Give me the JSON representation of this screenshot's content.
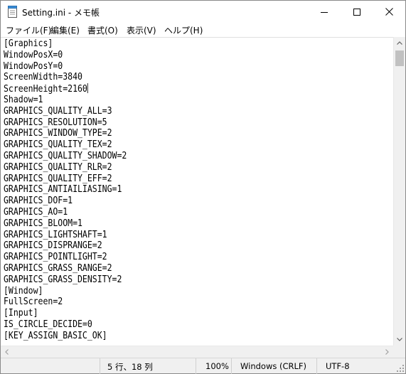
{
  "window": {
    "title": "Setting.ini - メモ帳",
    "icon": "notepad-icon"
  },
  "menu": [
    {
      "label": "ファイル(F)"
    },
    {
      "label": "編集(E)"
    },
    {
      "label": "書式(O)"
    },
    {
      "label": "表示(V)"
    },
    {
      "label": "ヘルプ(H)"
    }
  ],
  "editor": {
    "caret_line": 5,
    "lines": [
      "[Graphics]",
      "WindowPosX=0",
      "WindowPosY=0",
      "ScreenWidth=3840",
      "ScreenHeight=2160",
      "Shadow=1",
      "GRAPHICS_QUALITY_ALL=3",
      "GRAPHICS_RESOLUTION=5",
      "GRAPHICS_WINDOW_TYPE=2",
      "GRAPHICS_QUALITY_TEX=2",
      "GRAPHICS_QUALITY_SHADOW=2",
      "GRAPHICS_QUALITY_RLR=2",
      "GRAPHICS_QUALITY_EFF=2",
      "GRAPHICS_ANTIAILIASING=1",
      "GRAPHICS_DOF=1",
      "GRAPHICS_AO=1",
      "GRAPHICS_BLOOM=1",
      "GRAPHICS_LIGHTSHAFT=1",
      "GRAPHICS_DISPRANGE=2",
      "GRAPHICS_POINTLIGHT=2",
      "GRAPHICS_GRASS_RANGE=2",
      "GRAPHICS_GRASS_DENSITY=2",
      "[Window]",
      "FullScreen=2",
      "[Input]",
      "IS_CIRCLE_DECIDE=0",
      "[KEY_ASSIGN_BASIC_OK]"
    ]
  },
  "statusbar": {
    "position": "5 行、18 列",
    "zoom": "100%",
    "line_ending": "Windows (CRLF)",
    "encoding": "UTF-8"
  }
}
